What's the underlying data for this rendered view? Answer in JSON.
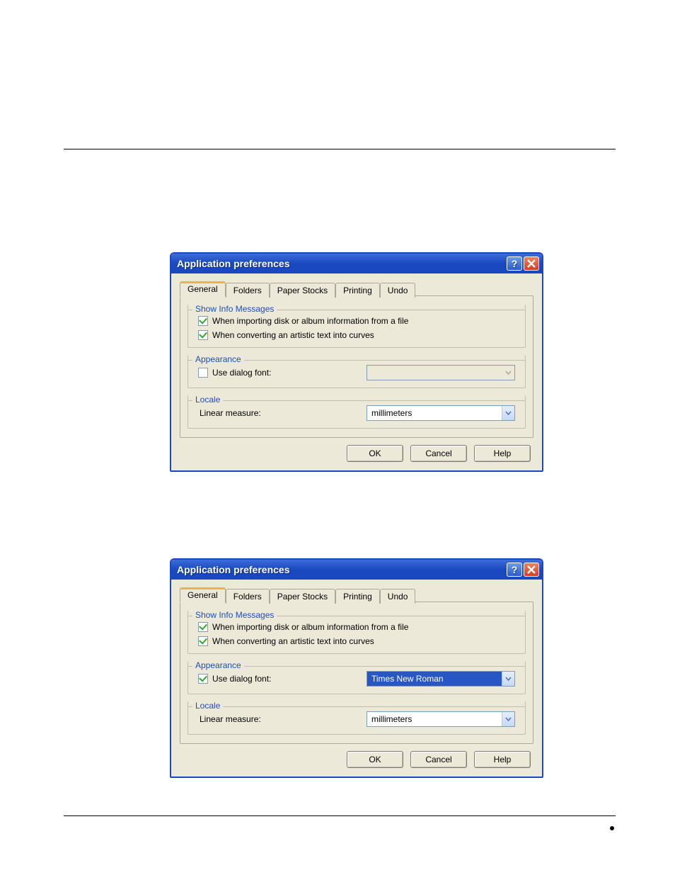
{
  "dialogs": [
    {
      "title": "Application preferences",
      "tabs": [
        {
          "label": "General",
          "active": true
        },
        {
          "label": "Folders",
          "active": false
        },
        {
          "label": "Paper Stocks",
          "active": false
        },
        {
          "label": "Printing",
          "active": false
        },
        {
          "label": "Undo",
          "active": false
        }
      ],
      "group_info": {
        "legend": "Show Info Messages",
        "check1_label": "When importing disk or album information from a file",
        "check1_checked": true,
        "check2_label": "When converting an artistic text into curves",
        "check2_checked": true
      },
      "group_appearance": {
        "legend": "Appearance",
        "check_label": "Use dialog font:",
        "check_checked": false,
        "font_value": "",
        "font_enabled": false
      },
      "group_locale": {
        "legend": "Locale",
        "label": "Linear measure:",
        "value": "millimeters"
      },
      "buttons": {
        "ok": "OK",
        "cancel": "Cancel",
        "help": "Help"
      }
    },
    {
      "title": "Application preferences",
      "tabs": [
        {
          "label": "General",
          "active": true
        },
        {
          "label": "Folders",
          "active": false
        },
        {
          "label": "Paper Stocks",
          "active": false
        },
        {
          "label": "Printing",
          "active": false
        },
        {
          "label": "Undo",
          "active": false
        }
      ],
      "group_info": {
        "legend": "Show Info Messages",
        "check1_label": "When importing disk or album information from a file",
        "check1_checked": true,
        "check2_label": "When converting an artistic text into curves",
        "check2_checked": true
      },
      "group_appearance": {
        "legend": "Appearance",
        "check_label": "Use dialog font:",
        "check_checked": true,
        "font_value": "Times New Roman",
        "font_enabled": true,
        "font_selected": true
      },
      "group_locale": {
        "legend": "Locale",
        "label": "Linear measure:",
        "value": "millimeters"
      },
      "buttons": {
        "ok": "OK",
        "cancel": "Cancel",
        "help": "Help"
      }
    }
  ]
}
